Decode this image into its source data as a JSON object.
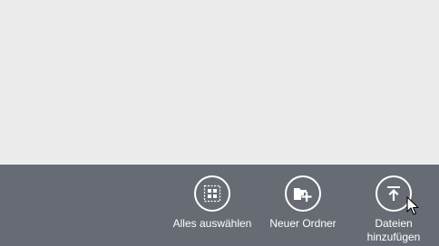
{
  "app_bar": {
    "commands": [
      {
        "label": "Alles auswählen",
        "icon": "select-all-icon"
      },
      {
        "label": "Neuer Ordner",
        "icon": "new-folder-icon"
      },
      {
        "label": "Dateien\nhinzufügen",
        "icon": "upload-icon"
      }
    ]
  },
  "colors": {
    "content_background": "#ececec",
    "app_bar_background": "#676b73",
    "foreground": "#ffffff"
  }
}
